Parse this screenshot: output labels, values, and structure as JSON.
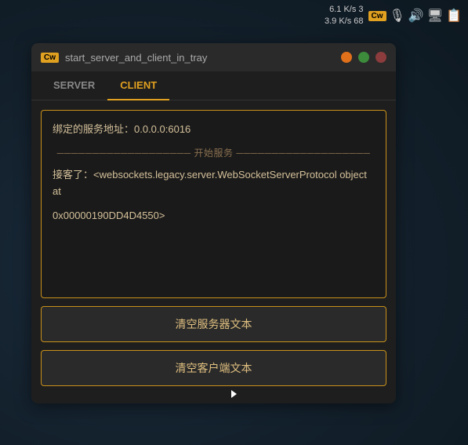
{
  "taskbar": {
    "stats_line1": "6.1  K/s    3",
    "stats_line2": "3.9  K/s   68",
    "badge": "Cw",
    "icons": [
      "mic-icon",
      "volume-icon",
      "network-icon",
      "tray-icon"
    ]
  },
  "window": {
    "title": "start_server_and_client_in_tray",
    "badge": "Cw",
    "tabs": [
      {
        "id": "server",
        "label": "SERVER",
        "active": false
      },
      {
        "id": "client",
        "label": "CLIENT",
        "active": true
      }
    ],
    "server_content": {
      "line1": "绑定的服务地址：0.0.0.0:6016",
      "divider": "开始服务",
      "line2": "接客了：<websockets.legacy.server.WebSocketServerProtocol object at",
      "line3": "0x00000190DD4D4550>"
    },
    "buttons": [
      {
        "id": "clear-server",
        "label": "清空服务器文本"
      },
      {
        "id": "clear-client",
        "label": "清空客户端文本"
      }
    ]
  }
}
